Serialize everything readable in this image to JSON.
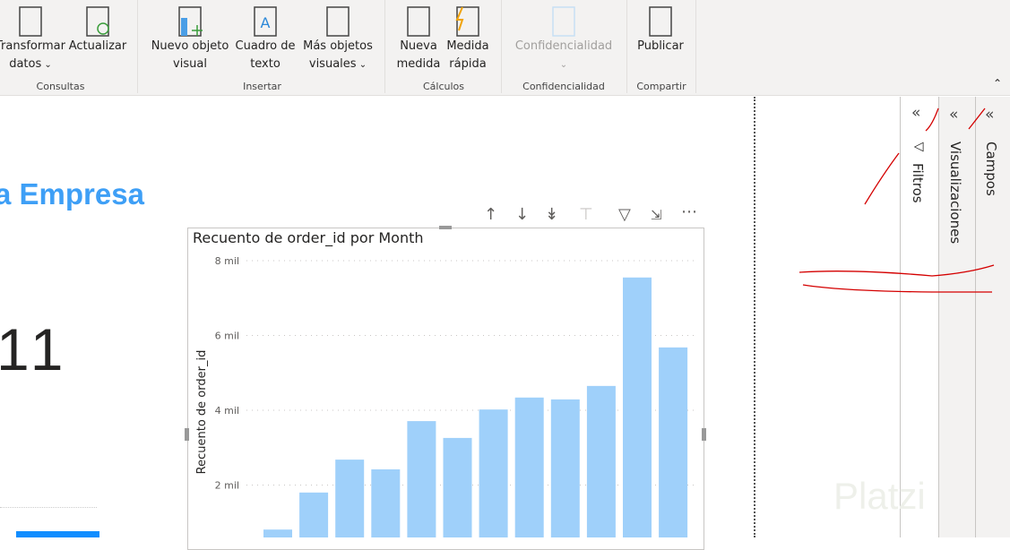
{
  "ribbon": {
    "buttons": [
      {
        "id": "transformar",
        "line1": "Transformar",
        "line2": "datos",
        "dropdown": true,
        "icon": "table-edit-icon"
      },
      {
        "id": "actualizar",
        "line1": "Actualizar",
        "line2": "",
        "icon": "refresh-icon"
      },
      {
        "id": "nuevo-objeto",
        "line1": "Nuevo objeto",
        "line2": "visual",
        "icon": "new-visual-icon"
      },
      {
        "id": "cuadro-texto",
        "line1": "Cuadro de",
        "line2": "texto",
        "icon": "text-box-icon"
      },
      {
        "id": "mas-objetos",
        "line1": "Más objetos",
        "line2": "visuales",
        "dropdown": true,
        "icon": "more-visuals-icon"
      },
      {
        "id": "nueva-medida",
        "line1": "Nueva",
        "line2": "medida",
        "icon": "calculator-icon"
      },
      {
        "id": "medida-rapida",
        "line1": "Medida",
        "line2": "rápida",
        "icon": "quick-measure-icon"
      },
      {
        "id": "confidencialidad",
        "line1": "Confidencialidad",
        "line2": "",
        "dropdown": true,
        "disabled": true,
        "icon": "sensitivity-icon"
      },
      {
        "id": "publicar",
        "line1": "Publicar",
        "line2": "",
        "icon": "publish-icon"
      }
    ],
    "groups": [
      "Consultas",
      "Insertar",
      "Cálculos",
      "Confidencialidad",
      "Compartir"
    ],
    "collapse_icon": "chevron-up-icon"
  },
  "report": {
    "title": "a Empresa",
    "kpi_value": "11"
  },
  "panes": {
    "filters": "Filtros",
    "visualizations": "Visualizaciones",
    "fields": "Campos"
  },
  "watermark": "Platzi",
  "colors": {
    "accent": "#3e9ff6",
    "bar": "#9fd0fa",
    "ribbon": "#f3f2f1",
    "annotation": "#d40000"
  },
  "chart_data": {
    "type": "bar",
    "title": "Recuento de order_id por Month",
    "ylabel": "Recuento de order_id",
    "xlabel": "",
    "ylim": [
      0,
      8000
    ],
    "yticks": [
      {
        "v": 2000,
        "label": "2 mil"
      },
      {
        "v": 4000,
        "label": "4 mil"
      },
      {
        "v": 6000,
        "label": "6 mil"
      },
      {
        "v": 8000,
        "label": "8 mil"
      }
    ],
    "grid": true,
    "values": [
      810,
      1800,
      2680,
      2420,
      3710,
      3260,
      4020,
      4340,
      4290,
      4650,
      7550,
      5680
    ]
  }
}
